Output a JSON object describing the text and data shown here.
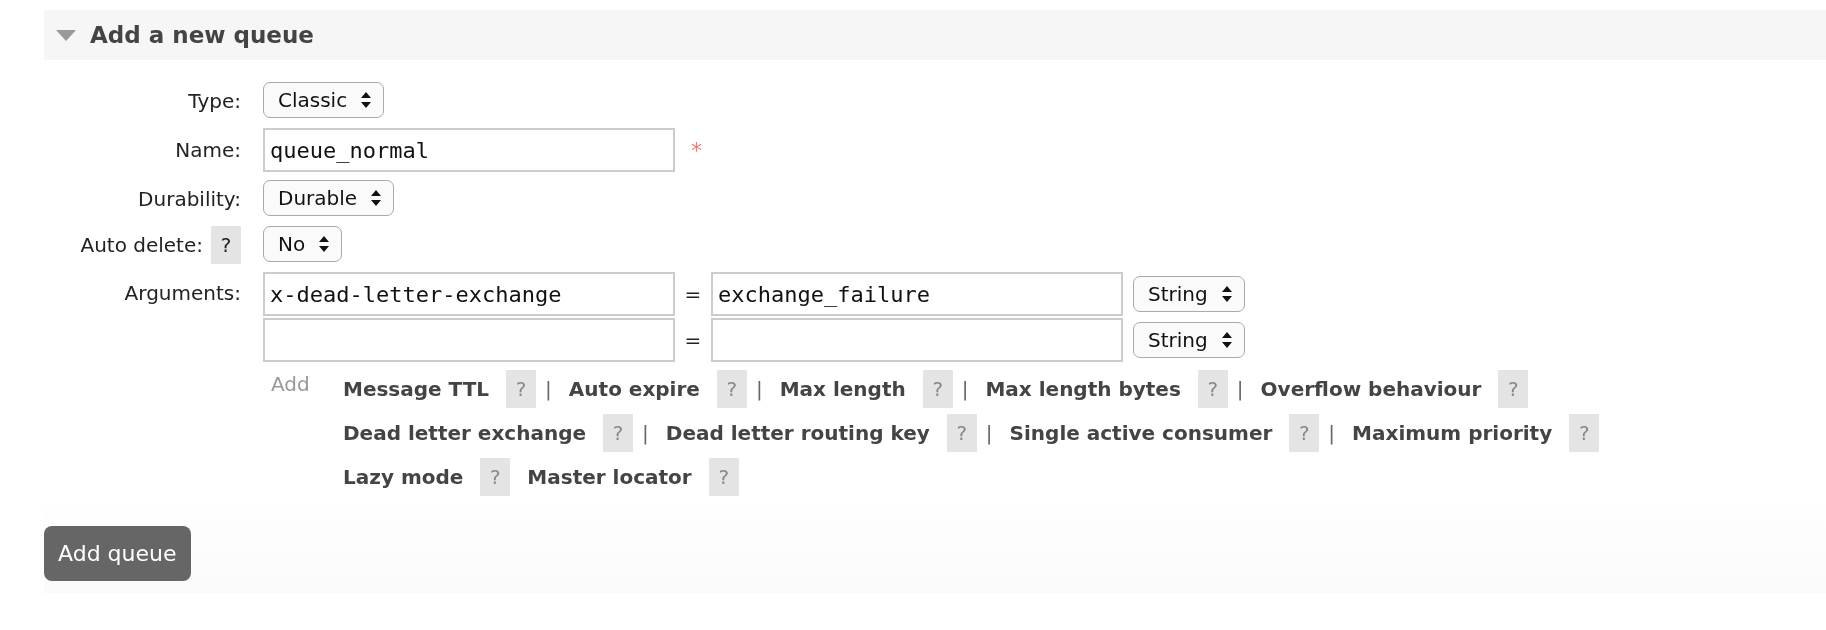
{
  "section": {
    "title": "Add a new queue",
    "expanded": true
  },
  "fields": [
    {
      "kind": "select",
      "label": "Type:",
      "value": "Classic"
    },
    {
      "kind": "text",
      "label": "Name:",
      "value": "queue_normal",
      "required_mark": "*"
    },
    {
      "kind": "select",
      "label": "Durability:",
      "value": "Durable"
    },
    {
      "kind": "select",
      "label": "Auto delete:",
      "help": "?",
      "value": "No"
    },
    {
      "kind": "arguments",
      "label": "Arguments:",
      "rows": [
        {
          "key": "x-dead-letter-exchange",
          "equals": "=",
          "value": "exchange_failure",
          "type": "String"
        },
        {
          "equals": "=",
          "type": "String"
        }
      ],
      "add_label": "Add",
      "helper_lines": [
        [
          {
            "label": "Message TTL",
            "help": "?",
            "separator": "|"
          },
          {
            "label": "Auto expire",
            "help": "?",
            "separator": "|"
          },
          {
            "label": "Max length",
            "help": "?",
            "separator": "|"
          },
          {
            "label": "Max length bytes",
            "help": "?",
            "separator": "|"
          },
          {
            "label": "Overflow behaviour",
            "help": "?"
          }
        ],
        [
          {
            "label": "Dead letter exchange",
            "help": "?",
            "separator": "|"
          },
          {
            "label": "Dead letter routing key",
            "help": "?",
            "separator": "|"
          },
          {
            "label": "Single active consumer",
            "help": "?",
            "separator": "|"
          },
          {
            "label": "Maximum priority",
            "help": "?"
          }
        ],
        [
          {
            "label": "Lazy mode",
            "help": "?"
          },
          {
            "label": "Master locator",
            "help": "?"
          }
        ]
      ]
    }
  ],
  "submit": {
    "label": "Add queue"
  }
}
